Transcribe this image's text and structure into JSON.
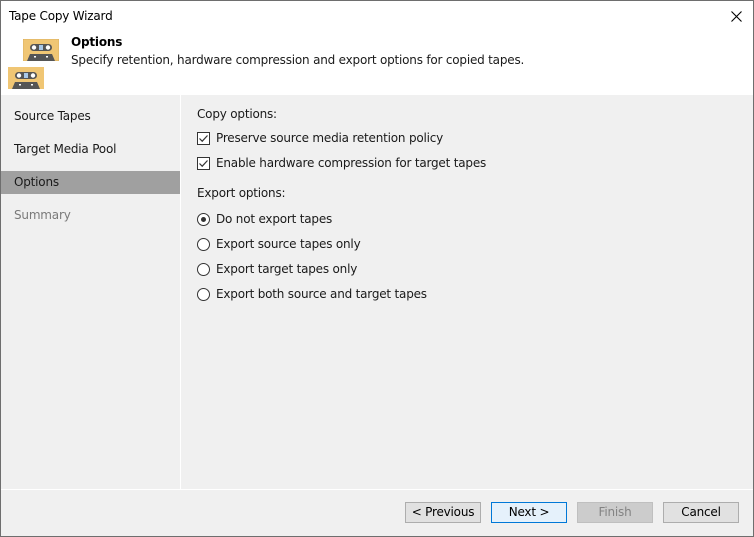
{
  "window": {
    "title": "Tape Copy Wizard",
    "close_icon": "close-icon"
  },
  "header": {
    "icon": "tape-cassette-icon",
    "title": "Options",
    "subtitle": "Specify retention, hardware compression and export options for copied tapes.",
    "icon_color": "#f0c674"
  },
  "sidebar": {
    "items": [
      {
        "label": "Source Tapes",
        "state": "normal"
      },
      {
        "label": "Target Media Pool",
        "state": "normal"
      },
      {
        "label": "Options",
        "state": "active"
      },
      {
        "label": "Summary",
        "state": "disabled"
      }
    ]
  },
  "copy_options": {
    "label": "Copy options:",
    "items": [
      {
        "label": "Preserve source media retention policy",
        "checked": true
      },
      {
        "label": "Enable hardware compression for target tapes",
        "checked": true
      }
    ]
  },
  "export_options": {
    "label": "Export options:",
    "selected": 0,
    "items": [
      {
        "label": "Do not export tapes"
      },
      {
        "label": "Export source tapes only"
      },
      {
        "label": "Export target tapes only"
      },
      {
        "label": "Export both source and target tapes"
      }
    ]
  },
  "footer": {
    "previous": "< Previous",
    "next": "Next >",
    "finish": "Finish",
    "cancel": "Cancel"
  }
}
